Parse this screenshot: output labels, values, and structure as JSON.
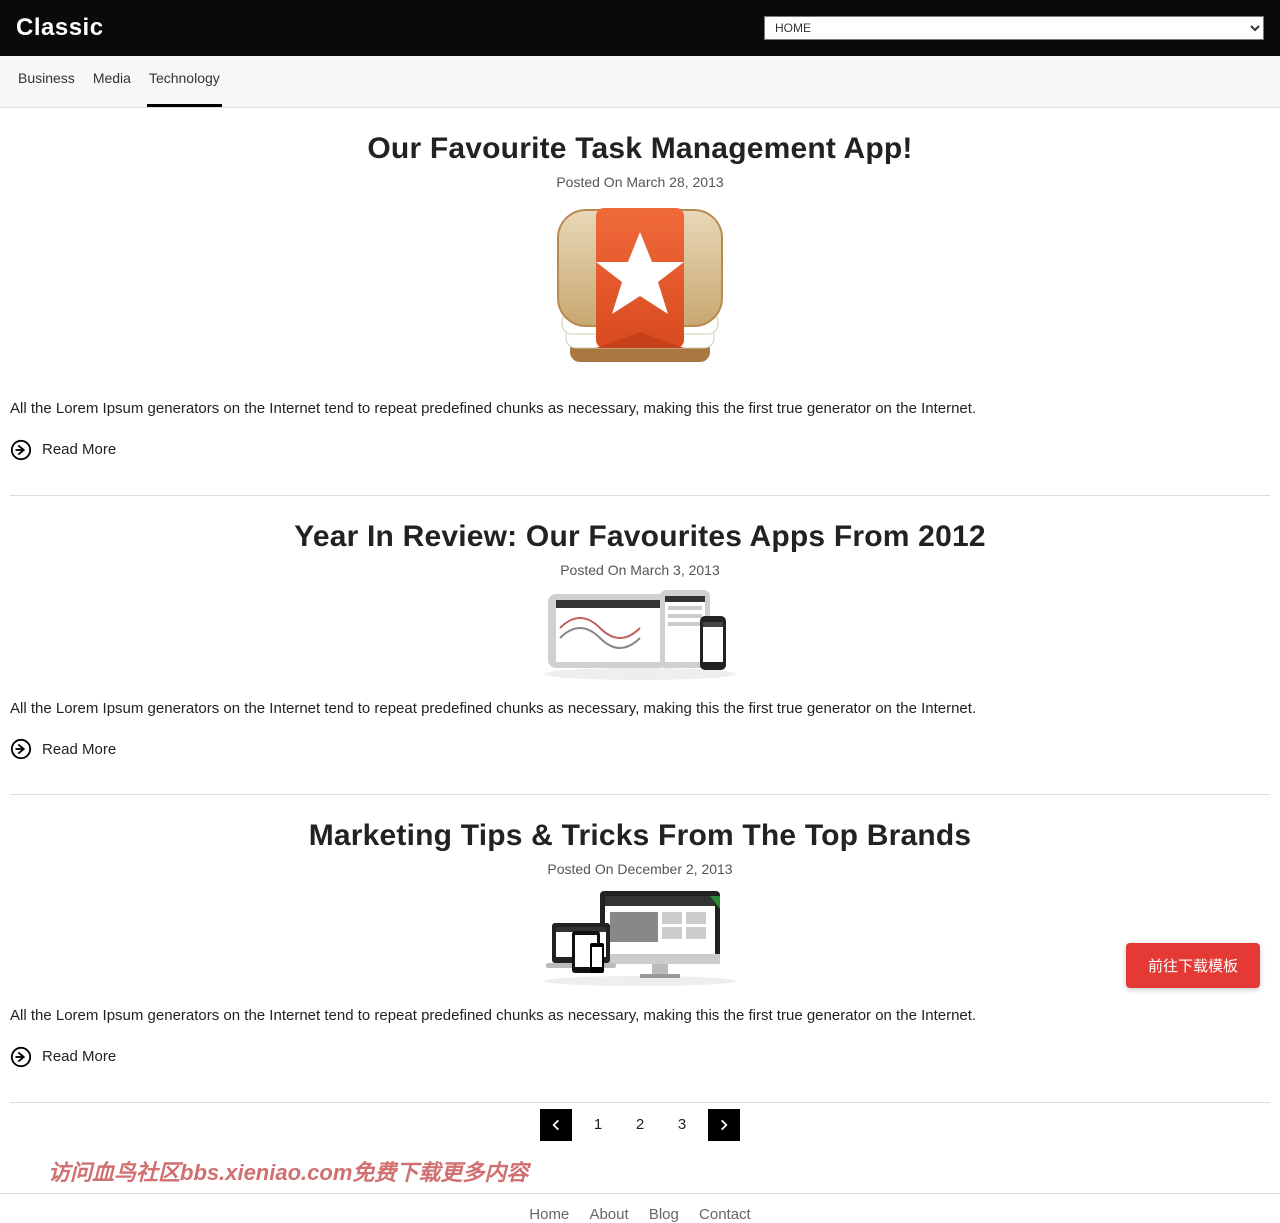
{
  "header": {
    "brand": "Classic",
    "nav_select_value": "HOME"
  },
  "categories": {
    "items": [
      "Business",
      "Media",
      "Technology"
    ],
    "active_index": 2
  },
  "posts": [
    {
      "title": "Our Favourite Task Management App!",
      "meta": "Posted On March 28, 2013",
      "excerpt": "All the Lorem Ipsum generators on the Internet tend to repeat predefined chunks as necessary, making this the first true generator on the Internet.",
      "readmore": "Read More",
      "image": "wunderlist-icon"
    },
    {
      "title": "Year In Review: Our Favourites Apps From 2012",
      "meta": "Posted On March 3, 2013",
      "excerpt": "All the Lorem Ipsum generators on the Internet tend to repeat predefined chunks as necessary, making this the first true generator on the Internet.",
      "readmore": "Read More",
      "image": "devices-mockup"
    },
    {
      "title": "Marketing Tips & Tricks From The Top Brands",
      "meta": "Posted On December 2, 2013",
      "excerpt": "All the Lorem Ipsum generators on the Internet tend to repeat predefined chunks as necessary, making this the first true generator on the Internet.",
      "readmore": "Read More",
      "image": "responsive-showcase"
    }
  ],
  "pagination": {
    "pages": [
      "1",
      "2",
      "3"
    ]
  },
  "fab": {
    "label": "前往下载模板"
  },
  "watermark": {
    "text": "访问血鸟社区bbs.xieniao.com免费下载更多内容"
  },
  "footer": {
    "items": [
      "Home",
      "About",
      "Blog",
      "Contact"
    ]
  }
}
